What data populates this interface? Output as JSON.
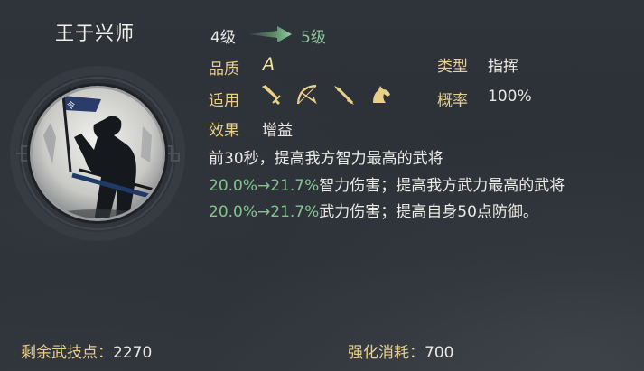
{
  "skill": {
    "name": "王于兴师",
    "level_from": "4级",
    "level_to": "5级"
  },
  "attributes": {
    "quality_label": "品质",
    "quality_value": "A",
    "type_label": "类型",
    "type_value": "指挥",
    "applies_label": "适用",
    "applies_icons": [
      "sword-icon",
      "bow-icon",
      "spear-icon",
      "horse-icon"
    ],
    "rate_label": "概率",
    "rate_value": "100%",
    "effect_label": "效果",
    "effect_value": "增益"
  },
  "description": {
    "part1": "前30秒，提高我方智力最高的武将",
    "hl1": "20.0%→21.7%",
    "part2": "智力伤害；提高我方武力最高的武将",
    "hl2": "20.0%→21.7%",
    "part3": "武力伤害；提高自身50点防御。"
  },
  "footer": {
    "remaining_label": "剩余武技点：",
    "remaining_value": "2270",
    "cost_label": "强化消耗：",
    "cost_value": "700"
  },
  "colors": {
    "gold_label": "#e8cf8a",
    "green_highlight": "#82c48f",
    "background": "#2b3036"
  }
}
